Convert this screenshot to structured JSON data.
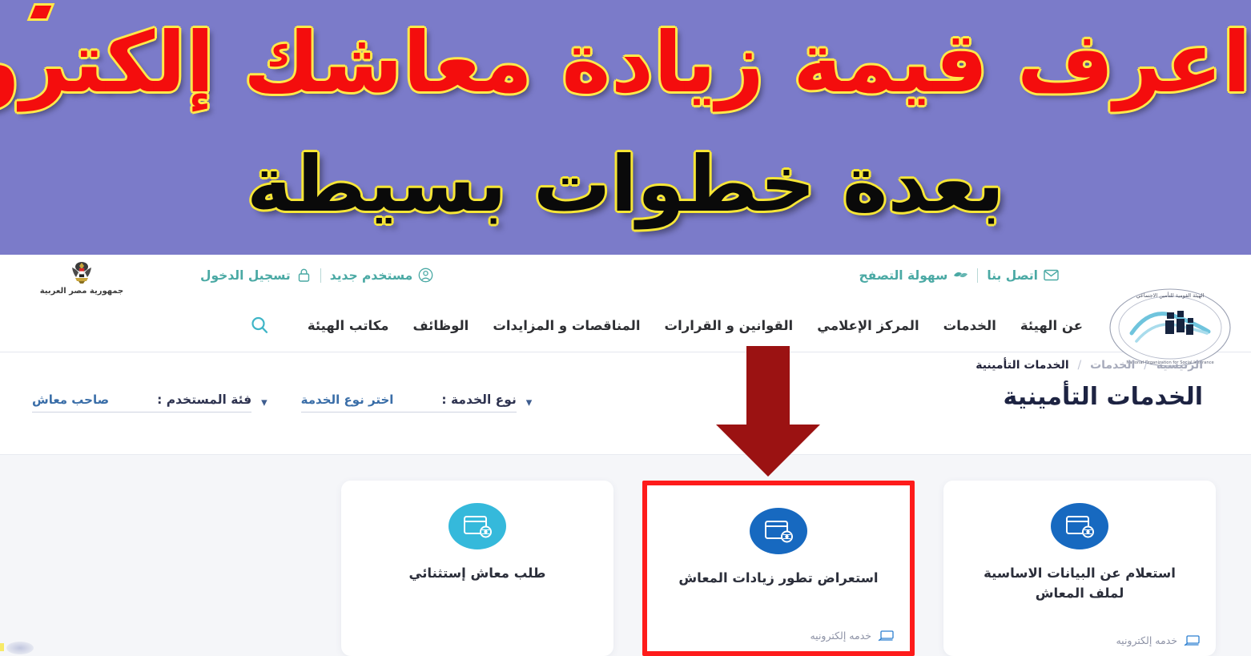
{
  "banner": {
    "line1": "اعرف قيمة زيادة معاشك  إلكترونياً",
    "line2": "بعدة خطوات بسيطة",
    "bg_color": "#7b7bc9",
    "line1_color": "#f40d0d",
    "line1_outline": "#ffe94a",
    "line2_color": "#0a0a0a",
    "line2_outline": "#f7e636"
  },
  "header": {
    "egypt_emblem_label": "جمهورية مصر العربية",
    "utility_right": [
      {
        "label": "اتصل بنا",
        "icon": "envelope-icon"
      },
      {
        "label": "سهولة التصفح",
        "icon": "accessibility-icon"
      }
    ],
    "utility_left": [
      {
        "label": "مستخدم جديد",
        "icon": "user-circle-icon"
      },
      {
        "label": "تسجيل الدخول",
        "icon": "lock-icon"
      }
    ],
    "nav_items": [
      {
        "label": "عن الهيئة"
      },
      {
        "label": "الخدمات"
      },
      {
        "label": "المركز الإعلامي"
      },
      {
        "label": "القوانين و القرارات"
      },
      {
        "label": "المناقصات و المزايدات"
      },
      {
        "label": "الوظائف"
      },
      {
        "label": "مكاتب الهيئة"
      }
    ],
    "search_icon": "search-icon",
    "accent_color": "#4aa9a4",
    "search_color": "#3fb5c7"
  },
  "breadcrumb": {
    "items": [
      "الرئيسية",
      "الخدمات"
    ],
    "current": "الخدمات التأمينية",
    "separator": "/"
  },
  "page": {
    "title": "الخدمات التأمينية"
  },
  "filters": [
    {
      "label": "فئة المستخدم :",
      "value": "صاحب معاش",
      "chevron": "▾"
    },
    {
      "label": "نوع الخدمة :",
      "value": "اختر نوع الخدمة",
      "chevron": "▾"
    }
  ],
  "cards": [
    {
      "title": "استعلام عن البيانات الاساسية لملف المعاش",
      "footer": "خدمه إلكترونيه",
      "icon_color": "#1769c0",
      "icon": "online-service-icon",
      "highlighted": false
    },
    {
      "title": "استعراض تطور زيادات المعاش",
      "footer": "خدمه إلكترونيه",
      "icon_color": "#1769c0",
      "icon": "online-service-icon",
      "highlighted": true,
      "highlight_color": "#fe1b1b"
    },
    {
      "title": "طلب معاش إستثنائي",
      "footer": "",
      "icon_color": "#35b9db",
      "icon": "online-service-icon",
      "highlighted": false
    }
  ],
  "annotation": {
    "arrow_color": "#9b1212",
    "arrow_direction": "down"
  }
}
